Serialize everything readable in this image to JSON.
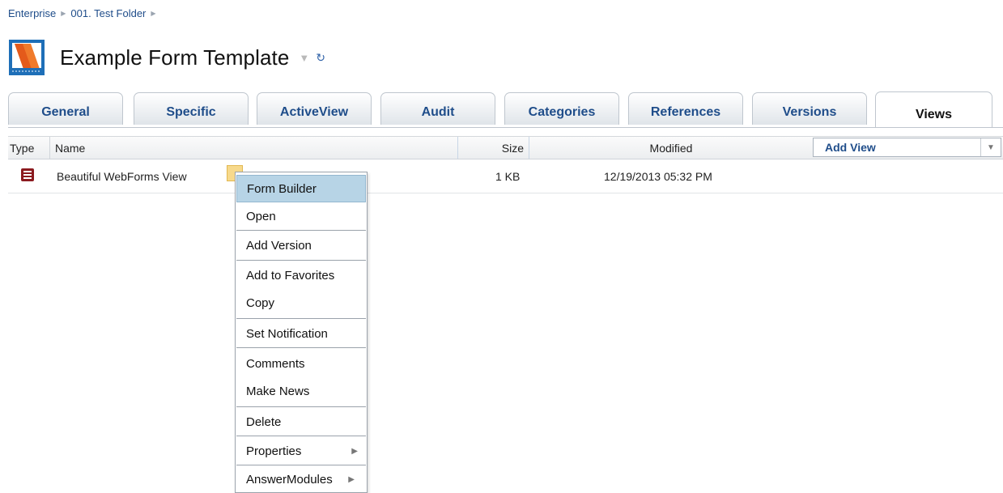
{
  "breadcrumb": [
    "Enterprise",
    "001. Test Folder"
  ],
  "title": "Example Form Template",
  "tabs": [
    {
      "label": "General"
    },
    {
      "label": "Specific"
    },
    {
      "label": "ActiveView"
    },
    {
      "label": "Audit"
    },
    {
      "label": "Categories"
    },
    {
      "label": "References"
    },
    {
      "label": "Versions"
    },
    {
      "label": "Views",
      "active": true
    }
  ],
  "table": {
    "columns": {
      "type": "Type",
      "name": "Name",
      "size": "Size",
      "modified": "Modified"
    },
    "add_view": "Add View",
    "rows": [
      {
        "name": "Beautiful WebForms View",
        "size": "1 KB",
        "modified": "12/19/2013 05:32 PM"
      }
    ]
  },
  "context_menu": {
    "items": [
      {
        "label": "Form Builder",
        "highlighted": true
      },
      {
        "label": "Open"
      },
      {
        "label": "Add Version"
      },
      {
        "label": "Add to Favorites"
      },
      {
        "label": "Copy"
      },
      {
        "label": "Set Notification"
      },
      {
        "label": "Comments"
      },
      {
        "label": "Make News"
      },
      {
        "label": "Delete"
      },
      {
        "label": "Properties",
        "submenu": true
      },
      {
        "label": "AnswerModules",
        "submenu": true
      }
    ]
  },
  "colors": {
    "link": "#1f4d8a",
    "highlight": "#b7d4e6",
    "row_icon": "#8b1a1f"
  }
}
